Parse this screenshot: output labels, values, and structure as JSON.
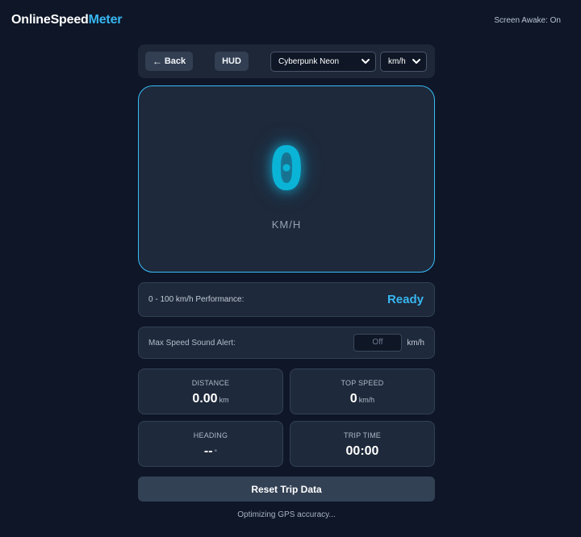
{
  "header": {
    "logo_part1": "OnlineSpeed",
    "logo_part2": "Meter",
    "screen_awake": "Screen Awake: On"
  },
  "toolbar": {
    "back_label": "Back",
    "hud_label": "HUD",
    "theme_selected": "Cyberpunk Neon",
    "unit_selected": "km/h"
  },
  "gauge": {
    "speed_value": "0",
    "unit_label": "KM/H"
  },
  "performance": {
    "label": "0 - 100 km/h Performance:",
    "status": "Ready"
  },
  "alert": {
    "label": "Max Speed Sound Alert:",
    "placeholder": "Off",
    "unit": "km/h"
  },
  "stats": {
    "distance": {
      "title": "DISTANCE",
      "value": "0.00",
      "unit": "km"
    },
    "top_speed": {
      "title": "TOP SPEED",
      "value": "0",
      "unit": "km/h"
    },
    "heading": {
      "title": "HEADING",
      "value": "--",
      "unit": "°"
    },
    "trip_time": {
      "title": "TRIP TIME",
      "value": "00:00",
      "unit": ""
    }
  },
  "reset_label": "Reset Trip Data",
  "status_text": "Optimizing GPS accuracy...",
  "colors": {
    "accent": "#38b6f0",
    "speed_glow": "#0ab4d6",
    "background": "#0e1628",
    "card": "#1e293b"
  },
  "icons": {
    "back": "arrow-left-icon",
    "dropdown": "chevron-down-icon"
  }
}
